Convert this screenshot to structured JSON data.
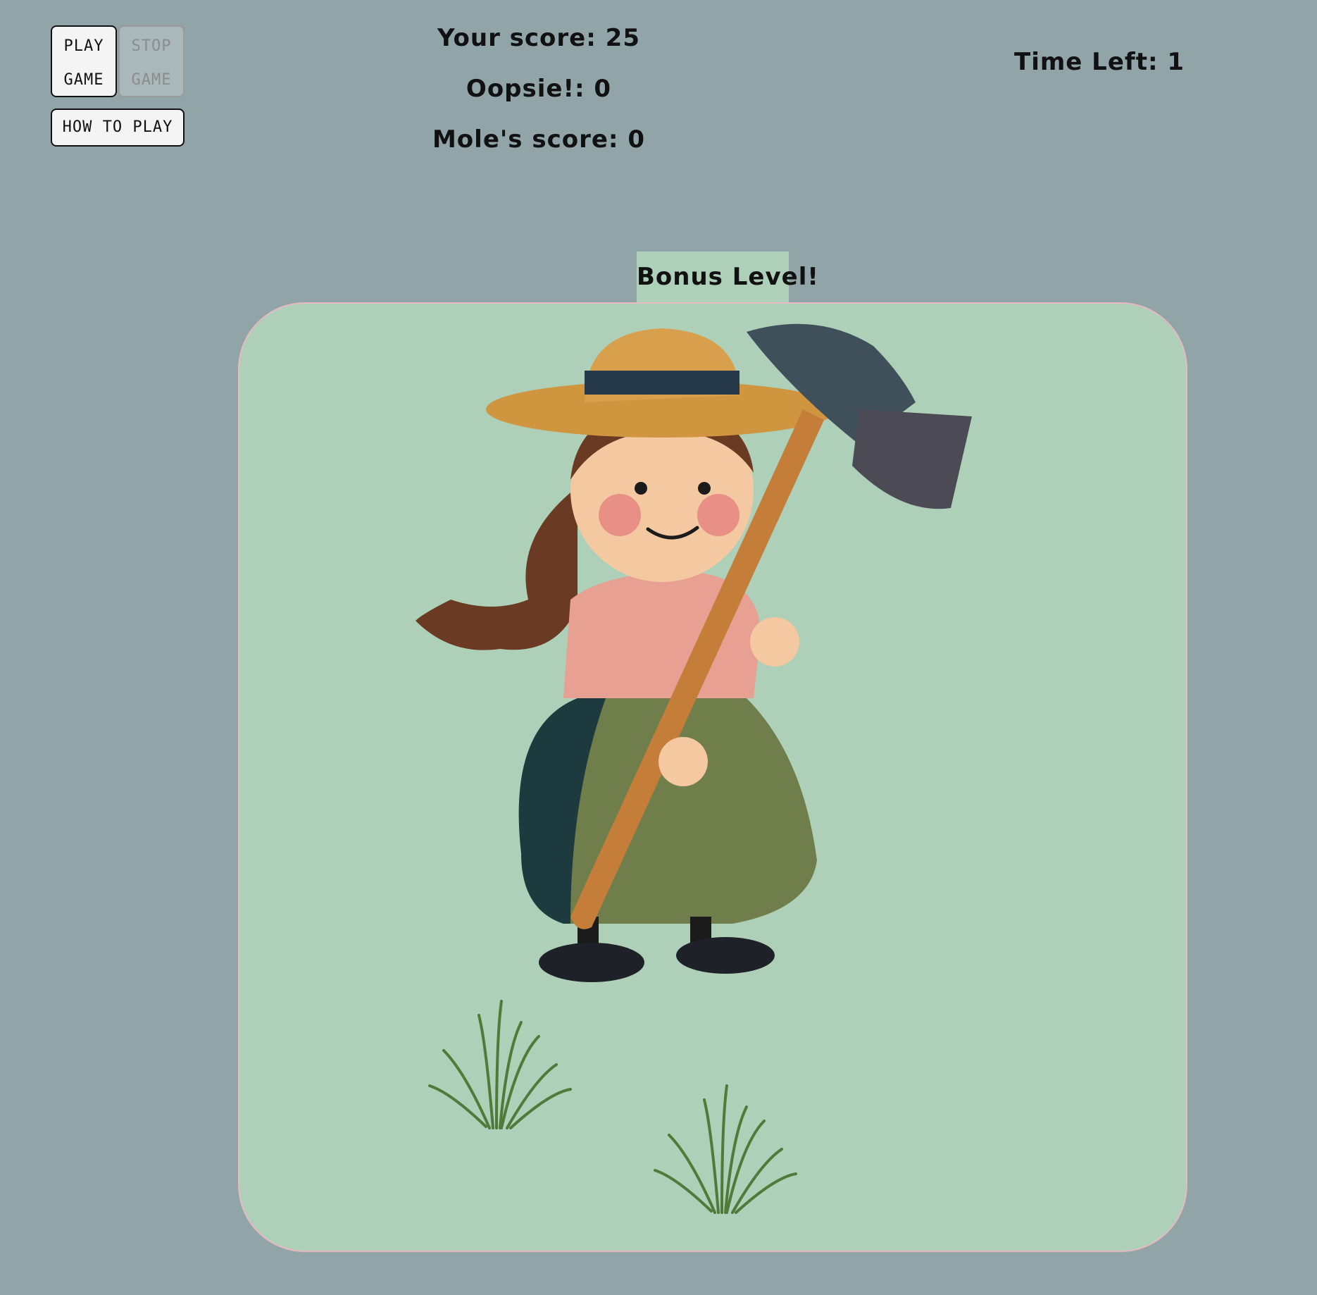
{
  "controls": {
    "play_line1": "PLAY",
    "play_line2": "GAME",
    "stop_line1": "STOP",
    "stop_line2": "GAME",
    "how_to_play": "HOW TO PLAY"
  },
  "stats": {
    "your_score": "Your score: 25",
    "oopsie": "Oopsie!: 0",
    "mole_score": "Mole's score: 0",
    "time_left": "Time Left: 1"
  },
  "level": {
    "banner": "Bonus Level!"
  },
  "board": {
    "character": "farmer-girl-with-hammer",
    "background_color": "#aecfb8",
    "border_color": "#e7b9c0"
  },
  "colors": {
    "page_background": "#91a5a8",
    "banner_background": "#aecfb8"
  }
}
